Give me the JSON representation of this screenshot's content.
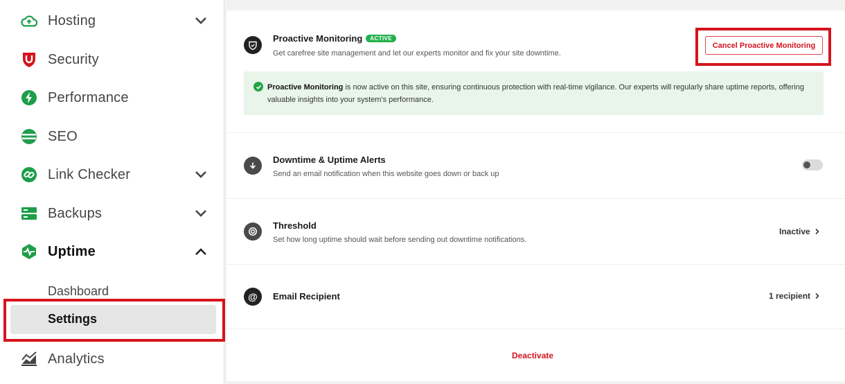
{
  "sidebar": {
    "items": [
      {
        "label": "Hosting",
        "icon": "cloud-icon"
      },
      {
        "label": "Security",
        "icon": "shield-icon"
      },
      {
        "label": "Performance",
        "icon": "bolt-icon"
      },
      {
        "label": "SEO",
        "icon": "seo-icon"
      },
      {
        "label": "Link Checker",
        "icon": "link-icon"
      },
      {
        "label": "Backups",
        "icon": "server-icon"
      },
      {
        "label": "Uptime",
        "icon": "heartbeat-icon"
      },
      {
        "label": "Analytics",
        "icon": "chart-icon"
      }
    ],
    "sub_items": [
      {
        "label": "Dashboard"
      },
      {
        "label": "Settings"
      }
    ]
  },
  "proactive": {
    "title": "Proactive Monitoring",
    "badge": "ACTIVE",
    "description": "Get carefree site management and let our experts monitor and fix your site downtime.",
    "cancel_label": "Cancel Proactive Monitoring",
    "notice_bold": "Proactive Monitoring",
    "notice_text": " is now active on this site, ensuring continuous protection with real-time vigilance. Our experts will regularly share uptime reports, offering valuable insights into your system's performance."
  },
  "alerts": {
    "title": "Downtime & Uptime Alerts",
    "description": "Send an email notification when this website goes down or back up",
    "toggle_on": false
  },
  "threshold": {
    "title": "Threshold",
    "description": "Set how long uptime should wait before sending out downtime notifications.",
    "status": "Inactive"
  },
  "email": {
    "title": "Email Recipient",
    "value": "1 recipient"
  },
  "deactivate_label": "Deactivate",
  "colors": {
    "accent_red": "#d4141e",
    "active_green": "#22b14c",
    "icon_green": "#1e9e4a"
  }
}
